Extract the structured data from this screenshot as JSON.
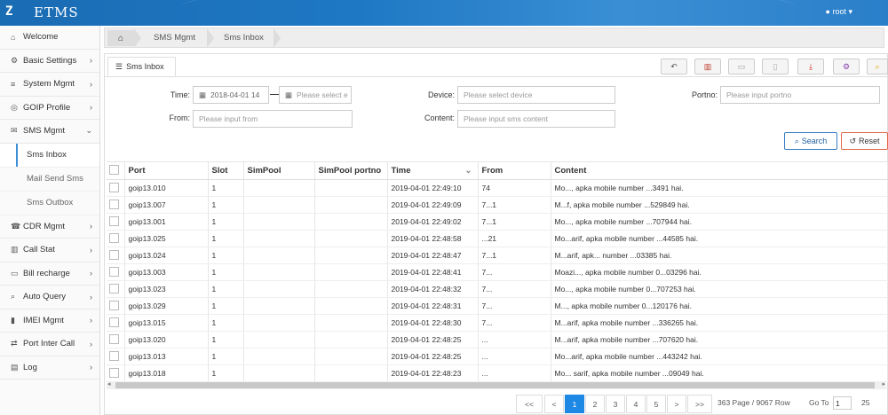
{
  "app": {
    "brand": "ETMS",
    "user": "root ▾"
  },
  "sidebar": [
    {
      "icon": "home-icon",
      "glyph": "⌂",
      "label": "Welcome",
      "arrow": ""
    },
    {
      "icon": "gear-icon",
      "glyph": "⚙",
      "label": "Basic Settings",
      "arrow": "›"
    },
    {
      "icon": "list-icon",
      "glyph": "≡",
      "label": "System Mgmt",
      "arrow": "›"
    },
    {
      "icon": "target-icon",
      "glyph": "◎",
      "label": "GOIP Profile",
      "arrow": "›"
    },
    {
      "icon": "chat-icon",
      "glyph": "✉",
      "label": "SMS Mgmt",
      "arrow": "⌄"
    }
  ],
  "sms_sub": [
    "Sms Inbox",
    "Mail Send Sms",
    "Sms Outbox"
  ],
  "sidebar2": [
    {
      "icon": "headset-icon",
      "glyph": "☎",
      "label": "CDR Mgmt",
      "arrow": "›"
    },
    {
      "icon": "bar-chart-icon",
      "glyph": "▥",
      "label": "Call Stat",
      "arrow": "›"
    },
    {
      "icon": "card-icon",
      "glyph": "▭",
      "label": "Bill recharge",
      "arrow": "›"
    },
    {
      "icon": "search-icon",
      "glyph": "⌕",
      "label": "Auto Query",
      "arrow": "›"
    },
    {
      "icon": "imei-icon",
      "glyph": "▮",
      "label": "IMEI Mgmt",
      "arrow": "›"
    },
    {
      "icon": "port-icon",
      "glyph": "⇄",
      "label": "Port Inter Call",
      "arrow": "›"
    },
    {
      "icon": "log-icon",
      "glyph": "▤",
      "label": "Log",
      "arrow": "›"
    }
  ],
  "breadcrumb": [
    "SMS Mgmt",
    "Sms Inbox"
  ],
  "tab": "Sms Inbox",
  "form": {
    "time_label": "Time:",
    "time_from": "2018-04-01 14",
    "time_to_placeholder": "Please select e",
    "device_label": "Device:",
    "device_placeholder": "Please select device",
    "portno_label": "Portno:",
    "portno_placeholder": "Please input portno",
    "from_label": "From:",
    "from_placeholder": "Please input from",
    "content_label": "Content:",
    "content_placeholder": "Please input sms content",
    "search": "Search",
    "reset": "Reset"
  },
  "columns": [
    "Port",
    "Slot",
    "SimPool",
    "SimPool portno",
    "Time",
    "From",
    "Content"
  ],
  "rows": [
    {
      "port": "goip13.010",
      "slot": "1",
      "time": "2019-04-01 22:49:10",
      "from": "74",
      "content": "Mo..., apka mobile number ...3491 hai."
    },
    {
      "port": "goip13.007",
      "slot": "1",
      "time": "2019-04-01 22:49:09",
      "from": "7...1",
      "content": "M...f, apka mobile number ...529849 hai."
    },
    {
      "port": "goip13.001",
      "slot": "1",
      "time": "2019-04-01 22:49:02",
      "from": "7...1",
      "content": "Mo..., apka mobile number ...707944 hai."
    },
    {
      "port": "goip13.025",
      "slot": "1",
      "time": "2019-04-01 22:48:58",
      "from": "...21",
      "content": "Mo...arif, apka mobile number ...44585 hai."
    },
    {
      "port": "goip13.024",
      "slot": "1",
      "time": "2019-04-01 22:48:47",
      "from": "7...1",
      "content": "M...arif, apk... number ...03385 hai."
    },
    {
      "port": "goip13.003",
      "slot": "1",
      "time": "2019-04-01 22:48:41",
      "from": "7...",
      "content": "Moazi..., apka mobile number 0...03296 hai."
    },
    {
      "port": "goip13.023",
      "slot": "1",
      "time": "2019-04-01 22:48:32",
      "from": "7...",
      "content": "Mo..., apka mobile number 0...707253 hai."
    },
    {
      "port": "goip13.029",
      "slot": "1",
      "time": "2019-04-01 22:48:31",
      "from": "7...",
      "content": "M..., apka mobile number 0...120176 hai."
    },
    {
      "port": "goip13.015",
      "slot": "1",
      "time": "2019-04-01 22:48:30",
      "from": "7...",
      "content": "M...arif, apka mobile number ...336265 hai."
    },
    {
      "port": "goip13.020",
      "slot": "1",
      "time": "2019-04-01 22:48:25",
      "from": "...",
      "content": "M...arif, apka mobile number ...707620 hai."
    },
    {
      "port": "goip13.013",
      "slot": "1",
      "time": "2019-04-01 22:48:25",
      "from": "...",
      "content": "Mo...arif, apka mobile number ...443242 hai."
    },
    {
      "port": "goip13.018",
      "slot": "1",
      "time": "2019-04-01 22:48:23",
      "from": "...",
      "content": "Mo... sarif, apka mobile number ...09049 hai."
    }
  ],
  "pager": {
    "first": "<<",
    "prev": "<",
    "pages": [
      "1",
      "2",
      "3",
      "4",
      "5"
    ],
    "next": ">",
    "last": ">>",
    "info": "363 Page / 9067 Row",
    "goto": "Go To",
    "goto_value": "1",
    "size": "25"
  }
}
